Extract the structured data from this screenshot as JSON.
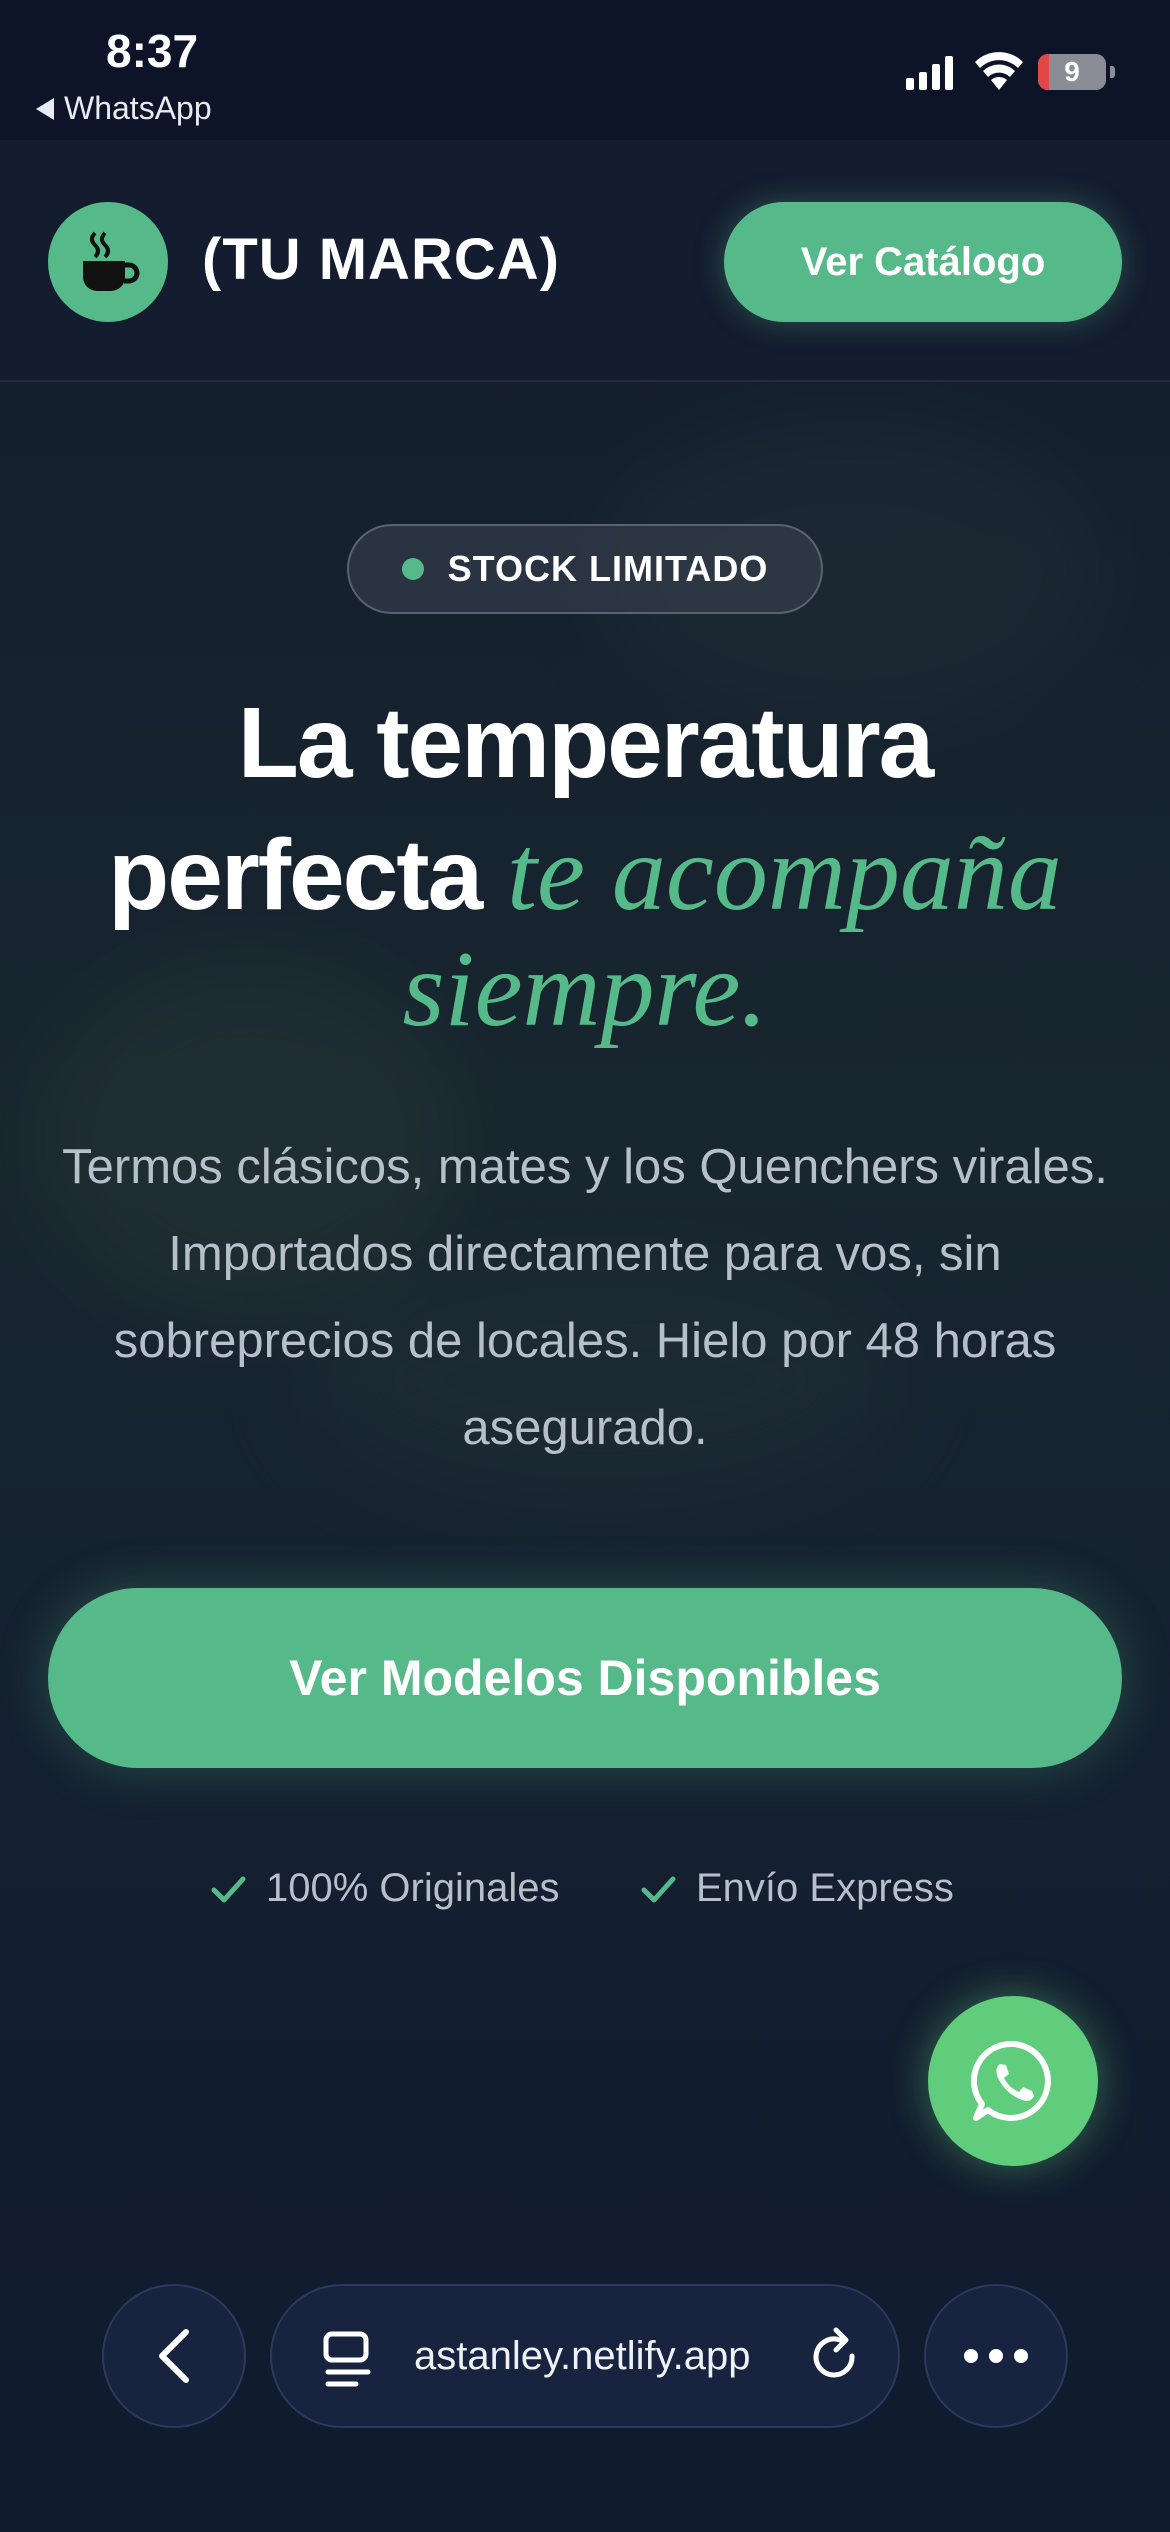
{
  "status_bar": {
    "time": "8:37",
    "back_app": "WhatsApp",
    "battery_level": "9"
  },
  "header": {
    "brand": "(TU MARCA)",
    "catalog_button": "Ver Catálogo",
    "logo_icon": "coffee-cup-icon"
  },
  "hero": {
    "badge": "STOCK LIMITADO",
    "title_line1": "La temperatura",
    "title_line2_plain": "perfecta ",
    "title_line2_accent": "te acompaña",
    "title_line3_accent": "siempre.",
    "description": "Termos clásicos, mates y los Quenchers virales. Importados directamente para vos, sin sobreprecios de locales. Hielo por 48 horas asegurado.",
    "cta_button": "Ver Modelos Disponibles",
    "features": [
      "100% Originales",
      "Envío Express"
    ]
  },
  "browser": {
    "url": "astanley.netlify.app"
  },
  "colors": {
    "accent": "#55b989",
    "whatsapp": "#5fcd7b",
    "background": "#111a2c"
  }
}
